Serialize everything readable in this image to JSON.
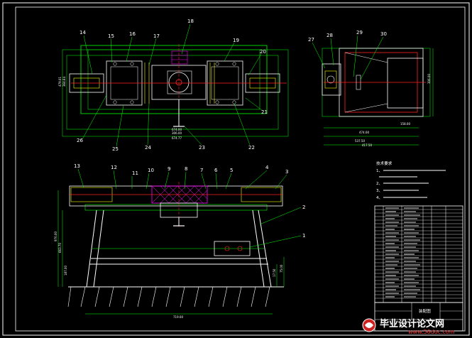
{
  "colors": {
    "background": "#000000",
    "frame": "#ffffff",
    "outline": "#00ff00",
    "part": "#ffffff",
    "center": "#ff2020",
    "dimension": "#00ff00",
    "hatch": "#ff00ff",
    "section": "#ffff00"
  },
  "top_view": {
    "part_numbers": [
      "14",
      "15",
      "16",
      "17",
      "18",
      "19",
      "20",
      "21",
      "22",
      "23",
      "24",
      "25",
      "26"
    ],
    "dimensions": [
      "674.00",
      "306.00",
      "674.77",
      "479.01",
      "364.64"
    ]
  },
  "side_view": {
    "part_numbers": [
      "27",
      "28",
      "29",
      "30"
    ],
    "dimensions": [
      "474.00",
      "537.50",
      "417.50",
      "158.00",
      "306.00"
    ]
  },
  "front_view": {
    "part_numbers": [
      "13",
      "12",
      "11",
      "10",
      "9",
      "8",
      "7",
      "6",
      "5",
      "4",
      "3",
      "2",
      "1"
    ],
    "dimensions": [
      "719.00",
      "970.00",
      "663.70",
      "187.00",
      "17.50",
      "75.00"
    ]
  },
  "tech_requirements": {
    "title": "技术要求",
    "items": [
      "1、",
      "2、",
      "3、",
      "4、"
    ]
  },
  "title_block": {
    "drawing_name": "装配图"
  },
  "watermark": {
    "site_name": "毕业设计论文网",
    "url": "www.56doc.com"
  }
}
